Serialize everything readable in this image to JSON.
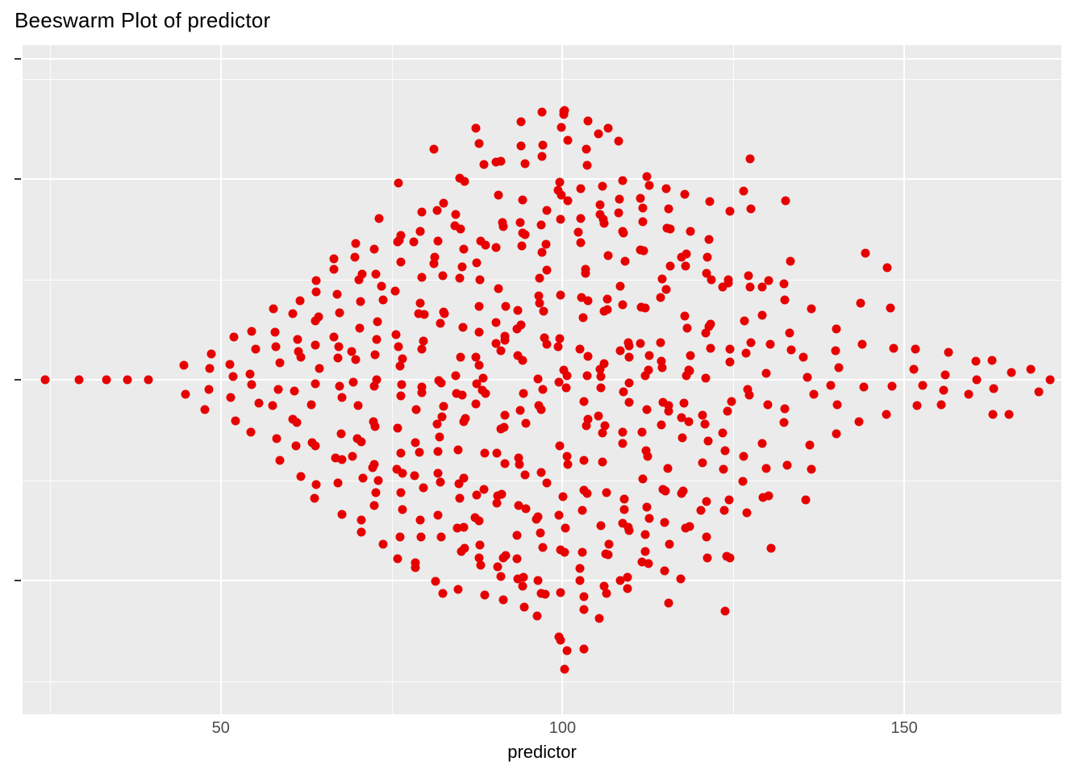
{
  "chart_data": {
    "type": "scatter",
    "title": "Beeswarm Plot of predictor",
    "xlabel": "predictor",
    "ylabel": "",
    "xlim": [
      21,
      173
    ],
    "ylim": [
      -1.25,
      1.25
    ],
    "x_ticks": [
      50,
      100,
      150
    ],
    "x_minor_ticks": [
      25,
      75,
      125
    ],
    "y_ticks": [
      -0.75,
      0,
      0.75,
      1.2
    ],
    "y_minor_ticks": [
      -1.125,
      -0.375,
      0.375,
      1.125
    ],
    "point_color": "#e60000",
    "series": [
      {
        "name": "predictor",
        "description": "Beeswarm distribution; each point's x is the predictor value, y is a jittered offset conveying local density.",
        "x_bins": [
          {
            "x": 25,
            "count": 1,
            "jitter_range": [
              0.0,
              0.0
            ]
          },
          {
            "x": 30,
            "count": 1,
            "jitter_range": [
              0.0,
              0.0
            ]
          },
          {
            "x": 34,
            "count": 1,
            "jitter_range": [
              0.0,
              0.0
            ]
          },
          {
            "x": 37,
            "count": 1,
            "jitter_range": [
              0.0,
              0.0
            ]
          },
          {
            "x": 40,
            "count": 1,
            "jitter_range": [
              0.0,
              0.0
            ]
          },
          {
            "x": 45,
            "count": 2,
            "jitter_range": [
              -0.05,
              0.05
            ]
          },
          {
            "x": 48,
            "count": 4,
            "jitter_range": [
              -0.1,
              0.1
            ]
          },
          {
            "x": 52,
            "count": 5,
            "jitter_range": [
              -0.14,
              0.14
            ]
          },
          {
            "x": 55,
            "count": 6,
            "jitter_range": [
              -0.18,
              0.18
            ]
          },
          {
            "x": 58,
            "count": 8,
            "jitter_range": [
              -0.28,
              0.28
            ]
          },
          {
            "x": 61,
            "count": 10,
            "jitter_range": [
              -0.34,
              0.34
            ]
          },
          {
            "x": 64,
            "count": 12,
            "jitter_range": [
              -0.42,
              0.42
            ]
          },
          {
            "x": 67,
            "count": 14,
            "jitter_range": [
              -0.48,
              0.48
            ]
          },
          {
            "x": 70,
            "count": 16,
            "jitter_range": [
              -0.55,
              0.55
            ]
          },
          {
            "x": 73,
            "count": 18,
            "jitter_range": [
              -0.6,
              0.6
            ]
          },
          {
            "x": 76,
            "count": 20,
            "jitter_range": [
              -0.66,
              0.66
            ]
          },
          {
            "x": 79,
            "count": 21,
            "jitter_range": [
              -0.7,
              0.7
            ]
          },
          {
            "x": 82,
            "count": 23,
            "jitter_range": [
              -0.76,
              0.76
            ]
          },
          {
            "x": 85,
            "count": 24,
            "jitter_range": [
              -0.8,
              0.8
            ]
          },
          {
            "x": 88,
            "count": 25,
            "jitter_range": [
              -0.83,
              0.83
            ]
          },
          {
            "x": 91,
            "count": 26,
            "jitter_range": [
              -0.86,
              0.86
            ]
          },
          {
            "x": 94,
            "count": 27,
            "jitter_range": [
              -0.9,
              0.9
            ]
          },
          {
            "x": 97,
            "count": 28,
            "jitter_range": [
              -0.95,
              0.95
            ]
          },
          {
            "x": 100,
            "count": 30,
            "jitter_range": [
              -1.18,
              1.18
            ]
          },
          {
            "x": 103,
            "count": 28,
            "jitter_range": [
              -0.95,
              0.95
            ]
          },
          {
            "x": 106,
            "count": 27,
            "jitter_range": [
              -0.9,
              0.9
            ]
          },
          {
            "x": 109,
            "count": 26,
            "jitter_range": [
              -0.86,
              0.86
            ]
          },
          {
            "x": 112,
            "count": 24,
            "jitter_range": [
              -0.8,
              0.8
            ]
          },
          {
            "x": 115,
            "count": 22,
            "jitter_range": [
              -0.73,
              0.73
            ]
          },
          {
            "x": 118,
            "count": 20,
            "jitter_range": [
              -0.66,
              0.66
            ]
          },
          {
            "x": 121,
            "count": 18,
            "jitter_range": [
              -0.6,
              0.6
            ]
          },
          {
            "x": 124,
            "count": 16,
            "jitter_range": [
              -0.8,
              0.55
            ]
          },
          {
            "x": 127,
            "count": 13,
            "jitter_range": [
              -0.45,
              0.78
            ]
          },
          {
            "x": 130,
            "count": 11,
            "jitter_range": [
              -0.6,
              0.38
            ]
          },
          {
            "x": 133,
            "count": 9,
            "jitter_range": [
              -0.3,
              0.62
            ]
          },
          {
            "x": 136,
            "count": 7,
            "jitter_range": [
              -0.44,
              0.24
            ]
          },
          {
            "x": 140,
            "count": 6,
            "jitter_range": [
              -0.2,
              0.2
            ]
          },
          {
            "x": 144,
            "count": 5,
            "jitter_range": [
              -0.16,
              0.5
            ]
          },
          {
            "x": 148,
            "count": 5,
            "jitter_range": [
              -0.14,
              0.45
            ]
          },
          {
            "x": 152,
            "count": 4,
            "jitter_range": [
              -0.1,
              0.1
            ]
          },
          {
            "x": 156,
            "count": 4,
            "jitter_range": [
              -0.1,
              0.1
            ]
          },
          {
            "x": 160,
            "count": 3,
            "jitter_range": [
              -0.06,
              0.06
            ]
          },
          {
            "x": 163,
            "count": 3,
            "jitter_range": [
              -0.14,
              0.06
            ]
          },
          {
            "x": 166,
            "count": 2,
            "jitter_range": [
              -0.14,
              0.04
            ]
          },
          {
            "x": 169,
            "count": 2,
            "jitter_range": [
              -0.04,
              0.04
            ]
          },
          {
            "x": 172,
            "count": 1,
            "jitter_range": [
              0.0,
              0.0
            ]
          }
        ]
      }
    ]
  }
}
